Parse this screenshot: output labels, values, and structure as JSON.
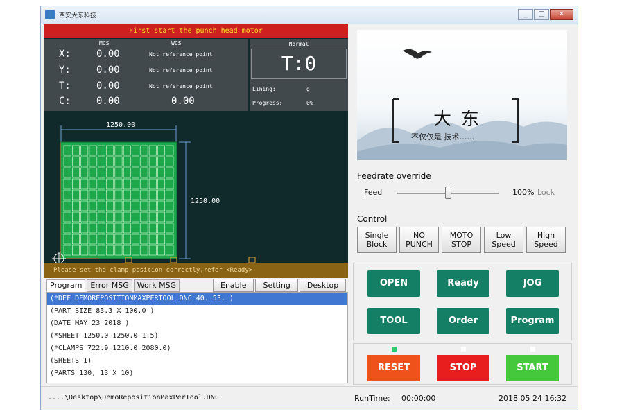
{
  "window": {
    "title": "西安大东科技",
    "controls": [
      "_",
      "□",
      "✕"
    ]
  },
  "message": "First start the punch head motor",
  "coords": {
    "mcs_header": "MCS",
    "wcs_header": "WCS",
    "mode": "Normal",
    "rows": [
      {
        "axis": "X:",
        "mcs": "0.00",
        "wcs": "Not reference point"
      },
      {
        "axis": "Y:",
        "mcs": "0.00",
        "wcs": "Not reference point"
      },
      {
        "axis": "T:",
        "mcs": "0.00",
        "wcs": "Not reference point"
      },
      {
        "axis": "C:",
        "mcs": "0.00",
        "wcs": "0.00"
      }
    ]
  },
  "tool": {
    "display": "T:0",
    "lining_label": "Lining:",
    "lining_value": "g",
    "progress_label": "Progress:",
    "progress_value": "0%"
  },
  "sheet": {
    "width_label": "1250.00",
    "height_label": "1250.00"
  },
  "status_strip": "Please set the clamp position correctly,refer <Ready>",
  "tabs": [
    {
      "label": "Program",
      "active": true
    },
    {
      "label": "Error MSG",
      "active": false
    },
    {
      "label": "Work MSG",
      "active": false
    }
  ],
  "tab_buttons": [
    "Enable",
    "Setting",
    "Desktop"
  ],
  "program_lines": [
    "(*DEF DEMOREPOSITIONMAXPERTOOL.DNC 40. 53. )",
    "(PART SIZE 83.3 X 100.0 )",
    "(DATE MAY 23 2018 )",
    "(*SHEET 1250.0 1250.0 1.5)",
    "(*CLAMPS 722.9 1210.0 2080.0)",
    "(SHEETS 1)",
    "(PARTS 130, 13 X 10)"
  ],
  "bottom": {
    "path": "....\\Desktop\\DemoRepositionMaxPerTool.DNC",
    "runtime_label": "RunTime:",
    "runtime_value": "00:00:00",
    "datetime": "2018 05 24 16:32"
  },
  "banner": {
    "main_text": "大东",
    "sub_text": "不仅仅是 技术……"
  },
  "feedrate": {
    "group_title": "Feedrate override",
    "feed_label": "Feed",
    "value": "100%",
    "lock_label": "Lock",
    "slider_fraction": 0.5
  },
  "control": {
    "group_title": "Control",
    "buttons": [
      {
        "line1": "Single",
        "line2": "Block"
      },
      {
        "line1": "NO",
        "line2": "PUNCH"
      },
      {
        "line1": "MOTO",
        "line2": "STOP"
      },
      {
        "line1": "Low",
        "line2": "Speed"
      },
      {
        "line1": "High",
        "line2": "Speed"
      }
    ]
  },
  "actions": [
    "OPEN",
    "Ready",
    "JOG",
    "TOOL",
    "Order",
    "Program"
  ],
  "run_buttons": {
    "reset": "RESET",
    "stop": "STOP",
    "start": "START"
  },
  "colors": {
    "msg_bg": "#cf1f1f",
    "msg_text": "#ffdc2e",
    "action_btn": "#147f64",
    "reset": "#f0521c",
    "stop": "#e81e1e",
    "start": "#46c83c",
    "sheet_green": "#1ea84b"
  }
}
